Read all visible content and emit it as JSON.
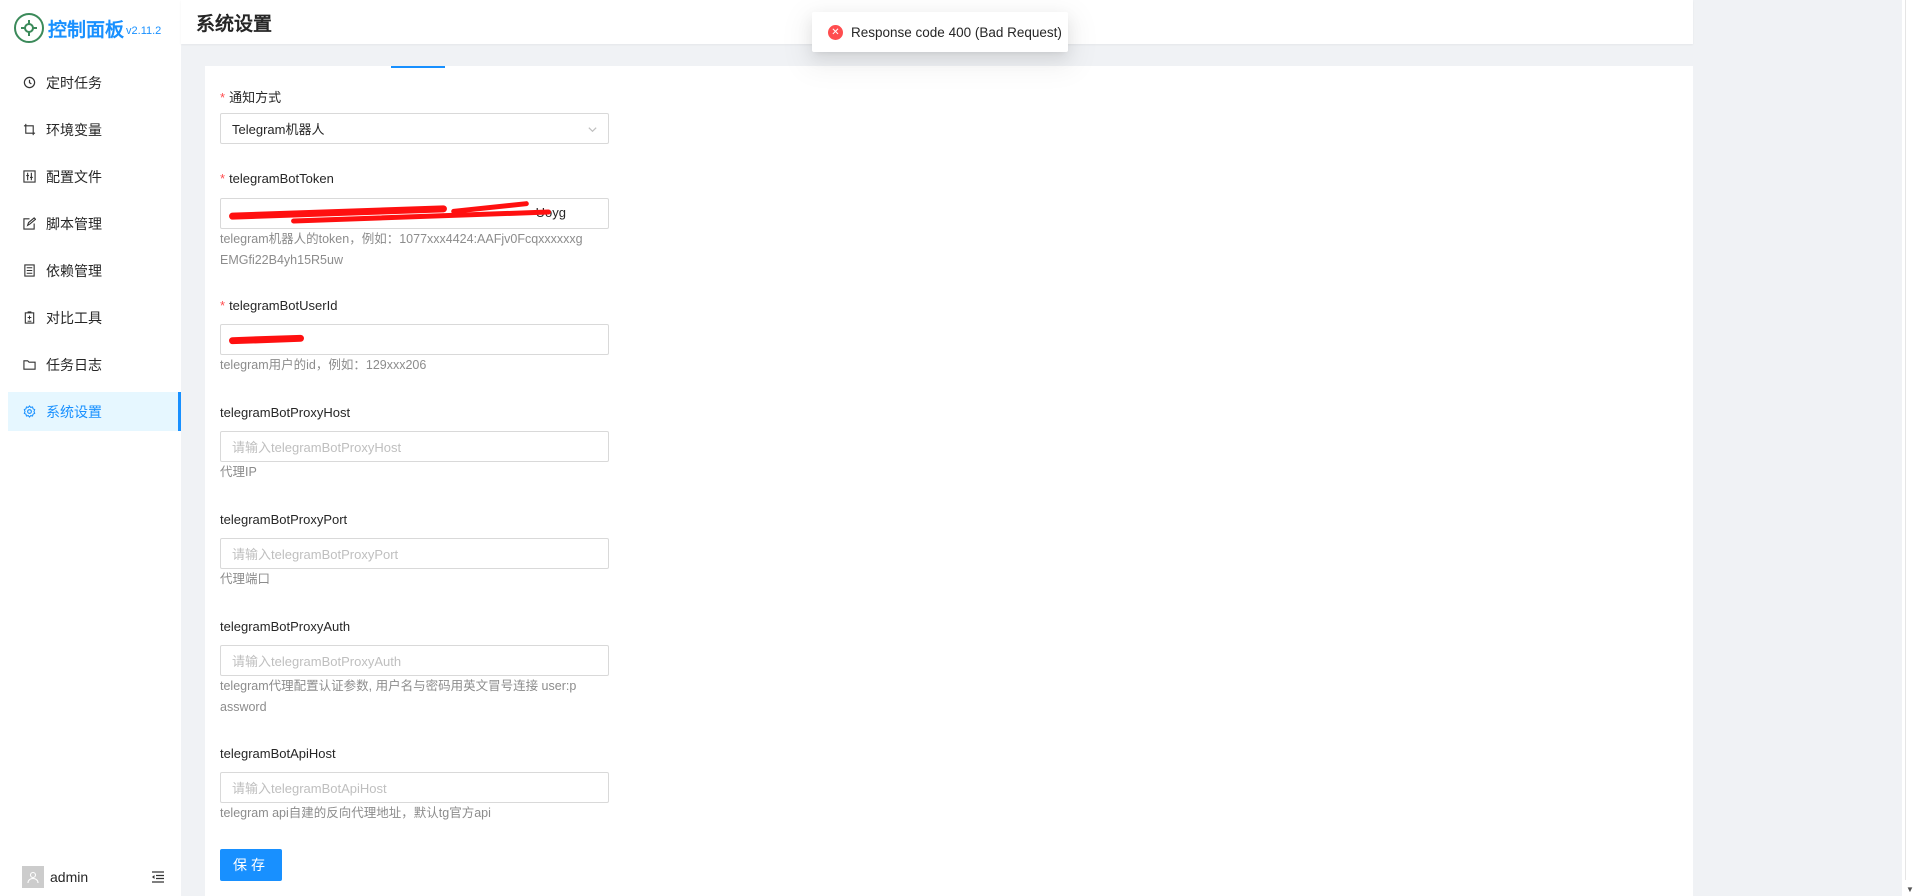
{
  "app": {
    "title": "控制面板",
    "version": "v2.11.2"
  },
  "header": {
    "title": "系统设置"
  },
  "sidebar": {
    "items": [
      {
        "label": "定时任务",
        "icon": "clock-icon"
      },
      {
        "label": "环境变量",
        "icon": "crop-icon"
      },
      {
        "label": "配置文件",
        "icon": "control-icon"
      },
      {
        "label": "脚本管理",
        "icon": "form-icon"
      },
      {
        "label": "依赖管理",
        "icon": "container-icon"
      },
      {
        "label": "对比工具",
        "icon": "diff-icon"
      },
      {
        "label": "任务日志",
        "icon": "folder-icon"
      },
      {
        "label": "系统设置",
        "icon": "setting-icon",
        "active": true
      }
    ],
    "user": {
      "name": "admin"
    }
  },
  "toast": {
    "message": "Response code 400 (Bad Request)",
    "type": "error"
  },
  "form": {
    "notify_method": {
      "label": "通知方式",
      "value": "Telegram机器人",
      "required": true
    },
    "bot_token": {
      "label": "telegramBotToken",
      "value_visible_tail": "Uoyg",
      "hint_line1": "telegram机器人的token，例如：1077xxx4424:AAFjv0Fcqxxxxxxg",
      "hint_line2": "EMGfi22B4yh15R5uw",
      "required": true
    },
    "bot_user_id": {
      "label": "telegramBotUserId",
      "hint": "telegram用户的id，例如：129xxx206",
      "required": true
    },
    "proxy_host": {
      "label": "telegramBotProxyHost",
      "placeholder": "请输入telegramBotProxyHost",
      "hint": "代理IP"
    },
    "proxy_port": {
      "label": "telegramBotProxyPort",
      "placeholder": "请输入telegramBotProxyPort",
      "hint": "代理端口"
    },
    "proxy_auth": {
      "label": "telegramBotProxyAuth",
      "placeholder": "请输入telegramBotProxyAuth",
      "hint_line1": "telegram代理配置认证参数, 用户名与密码用英文冒号连接 user:p",
      "hint_line2": "assword"
    },
    "api_host": {
      "label": "telegramBotApiHost",
      "placeholder": "请输入telegramBotApiHost",
      "hint": "telegram api自建的反向代理地址，默认tg官方api"
    },
    "save_label": "保存"
  },
  "colors": {
    "primary": "#1890ff",
    "error": "#ff4d4f",
    "redaction": "#ff1010"
  }
}
